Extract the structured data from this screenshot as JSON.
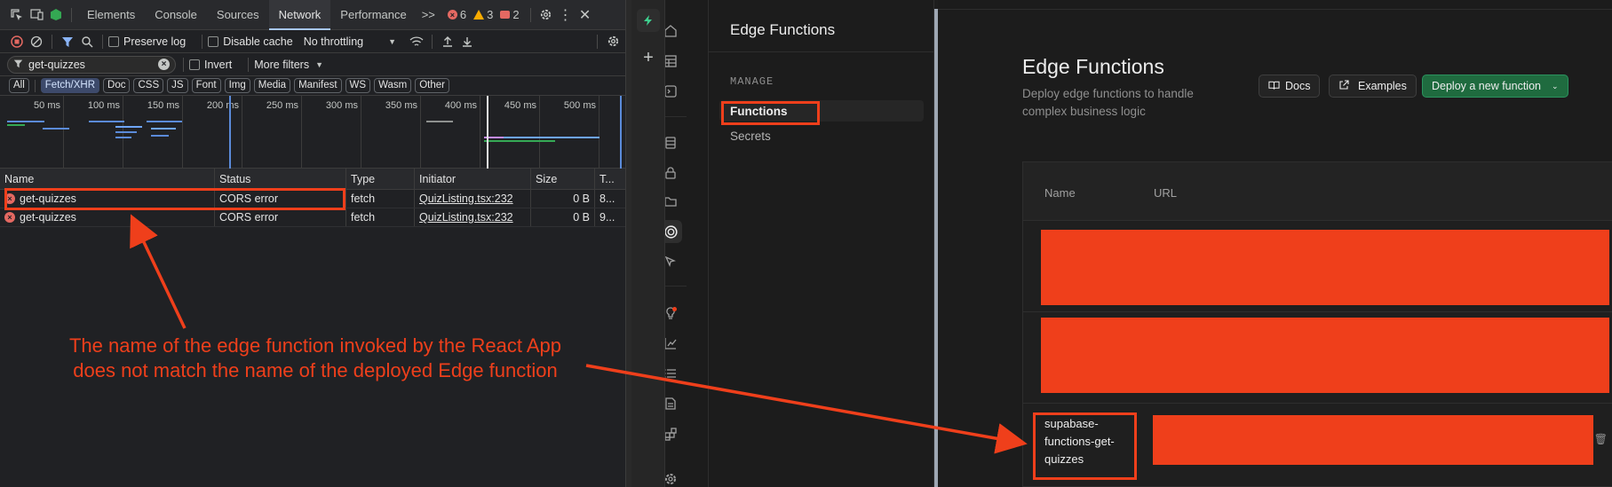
{
  "devtools": {
    "tabs": [
      "Elements",
      "Console",
      "Sources",
      "Network",
      "Performance"
    ],
    "active_tab": "Network",
    "more_tabs": ">>",
    "counts": {
      "errors": "6",
      "warnings": "3",
      "messages": "2"
    },
    "toolbar": {
      "preserve_log": "Preserve log",
      "disable_cache": "Disable cache",
      "throttling": "No throttling"
    },
    "filter": {
      "value": "get-quizzes",
      "invert": "Invert",
      "more_filters": "More filters"
    },
    "types": [
      "All",
      "Fetch/XHR",
      "Doc",
      "CSS",
      "JS",
      "Font",
      "Img",
      "Media",
      "Manifest",
      "WS",
      "Wasm",
      "Other"
    ],
    "active_type": "Fetch/XHR",
    "ticks": [
      "50 ms",
      "100 ms",
      "150 ms",
      "200 ms",
      "250 ms",
      "300 ms",
      "350 ms",
      "400 ms",
      "450 ms",
      "500 ms"
    ],
    "columns": {
      "name": "Name",
      "status": "Status",
      "type": "Type",
      "initiator": "Initiator",
      "size": "Size",
      "time": "T..."
    },
    "rows": [
      {
        "name": "get-quizzes",
        "status": "CORS error",
        "type": "fetch",
        "initiator": "QuizListing.tsx:232",
        "size": "0 B",
        "time": "8..."
      },
      {
        "name": "get-quizzes",
        "status": "CORS error",
        "type": "fetch",
        "initiator": "QuizListing.tsx:232",
        "size": "0 B",
        "time": "9..."
      }
    ]
  },
  "supabase": {
    "menu": {
      "title": "Edge Functions",
      "section": "MANAGE",
      "items": [
        "Functions",
        "Secrets"
      ],
      "active": "Functions"
    },
    "page": {
      "title": "Edge Functions",
      "subtitle": "Deploy edge functions to handle complex business logic",
      "buttons": {
        "docs": "Docs",
        "examples": "Examples",
        "deploy": "Deploy a new function"
      }
    },
    "table": {
      "columns": {
        "name": "Name",
        "url": "URL"
      },
      "visible_function_name": "supabase-functions-get-quizzes"
    }
  },
  "annotation": {
    "line1": "The name of the edge function invoked by the React App",
    "line2": "does not match the name of the deployed Edge function",
    "color": "#ef3f1b"
  },
  "colors": {
    "accent_red": "#ef3f1b",
    "devtools_bg": "#202124",
    "supabase_bg": "#1c1c1c",
    "deploy_green": "#1f6b3f"
  }
}
